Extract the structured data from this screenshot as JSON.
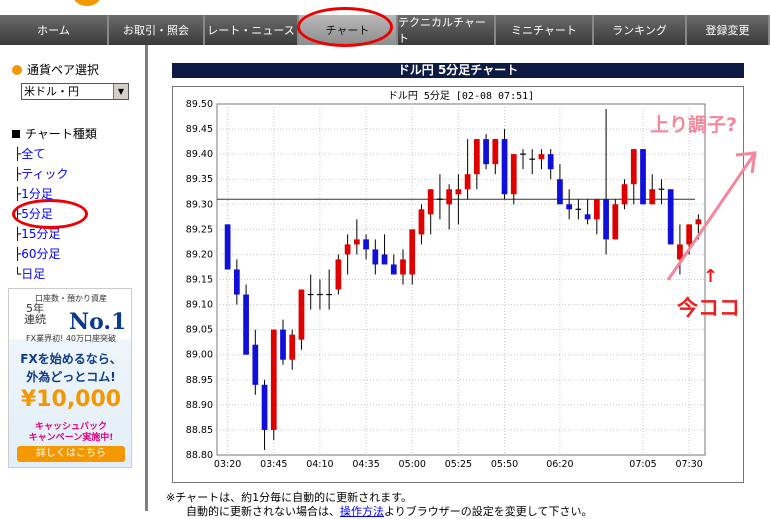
{
  "nav": {
    "tabs": [
      {
        "label": "ホーム",
        "active": false
      },
      {
        "label": "お取引・照会",
        "active": false
      },
      {
        "label": "レート・ニュース",
        "active": false
      },
      {
        "label": "チャート",
        "active": true
      },
      {
        "label": "テクニカルチャート",
        "active": false
      },
      {
        "label": "ミニチャート",
        "active": false
      },
      {
        "label": "ランキング",
        "active": false
      },
      {
        "label": "登録変更",
        "active": false
      }
    ]
  },
  "sidebar": {
    "pair_title": "通貨ペア選択",
    "pair_selected": "米ドル・円",
    "chart_type_title": "チャート種類",
    "chart_types": [
      {
        "tee": "├",
        "label": "全て"
      },
      {
        "tee": "├",
        "label": "ティック"
      },
      {
        "tee": "├",
        "label": "1分足"
      },
      {
        "tee": "├",
        "label": "5分足"
      },
      {
        "tee": "├",
        "label": "15分足"
      },
      {
        "tee": "├",
        "label": "60分足"
      },
      {
        "tee": "└",
        "label": "日足"
      }
    ]
  },
  "banner": {
    "line1": "口座数・預かり資産",
    "years": "5年",
    "consecutive": "連続",
    "no1": "No.1",
    "line3": "FX業界初! 40万口座突破",
    "fx_line": "FXを始めるなら、",
    "company": "外為どっとコム!",
    "amount": "¥10,000",
    "cashback": "キャッシュバック",
    "campaign": "キャンペーン実施中!",
    "details": "詳しくはこちら"
  },
  "main": {
    "title": "ドル円 5分足チャート",
    "note1": "※チャートは、約1分毎に自動的に更新されます。",
    "note2_pre": "自動的に更新されない場合は、",
    "note2_link": "操作方法",
    "note2_post": "よりブラウザーの設定を変更して下さい。"
  },
  "annotations": {
    "trend": "上り調子?",
    "now": "今ココ",
    "arrow": "↑"
  },
  "colors": {
    "up": "#e00000",
    "down": "#1010d8",
    "nav_active": "#a8a8a8",
    "title_bar": "#0d1a44",
    "annotation_red": "#ee1c1c",
    "annotation_pink": "#f6869c"
  },
  "chart_data": {
    "type": "candlestick",
    "title": "ドル円 5分足 [02-08 07:51]",
    "ylim": [
      88.8,
      89.5
    ],
    "y_ticks": [
      "89.50",
      "89.45",
      "89.40",
      "89.35",
      "89.30",
      "89.25",
      "89.20",
      "89.15",
      "89.10",
      "89.05",
      "89.00",
      "88.95",
      "88.90",
      "88.85",
      "88.80"
    ],
    "x_ticks": [
      "03:20",
      "03:45",
      "04:10",
      "04:35",
      "05:00",
      "05:25",
      "05:50",
      "06:20",
      "07:05",
      "07:30"
    ],
    "x_tick_index": [
      0,
      5,
      10,
      15,
      20,
      25,
      30,
      36,
      45,
      50
    ],
    "reference_line": 89.31,
    "candles": [
      {
        "o": 89.26,
        "h": 89.26,
        "l": 89.17,
        "c": 89.17
      },
      {
        "o": 89.17,
        "h": 89.19,
        "l": 89.1,
        "c": 89.12
      },
      {
        "o": 89.12,
        "h": 89.14,
        "l": 89.02,
        "c": 89.0
      },
      {
        "o": 89.02,
        "h": 89.05,
        "l": 88.92,
        "c": 88.94
      },
      {
        "o": 88.94,
        "h": 88.95,
        "l": 88.81,
        "c": 88.85
      },
      {
        "o": 88.85,
        "h": 89.05,
        "l": 88.83,
        "c": 89.05
      },
      {
        "o": 89.05,
        "h": 89.07,
        "l": 88.98,
        "c": 88.99
      },
      {
        "o": 88.99,
        "h": 89.05,
        "l": 88.97,
        "c": 89.04
      },
      {
        "o": 89.03,
        "h": 89.13,
        "l": 89.01,
        "c": 89.13
      },
      {
        "o": 89.12,
        "h": 89.16,
        "l": 89.09,
        "c": 89.12
      },
      {
        "o": 89.12,
        "h": 89.15,
        "l": 89.09,
        "c": 89.12
      },
      {
        "o": 89.12,
        "h": 89.17,
        "l": 89.09,
        "c": 89.12
      },
      {
        "o": 89.13,
        "h": 89.2,
        "l": 89.12,
        "c": 89.19
      },
      {
        "o": 89.2,
        "h": 89.24,
        "l": 89.16,
        "c": 89.22
      },
      {
        "o": 89.22,
        "h": 89.27,
        "l": 89.2,
        "c": 89.23
      },
      {
        "o": 89.23,
        "h": 89.24,
        "l": 89.19,
        "c": 89.21
      },
      {
        "o": 89.21,
        "h": 89.23,
        "l": 89.16,
        "c": 89.18
      },
      {
        "o": 89.2,
        "h": 89.24,
        "l": 89.18,
        "c": 89.18
      },
      {
        "o": 89.18,
        "h": 89.2,
        "l": 89.16,
        "c": 89.16
      },
      {
        "o": 89.16,
        "h": 89.21,
        "l": 89.14,
        "c": 89.19
      },
      {
        "o": 89.16,
        "h": 89.25,
        "l": 89.14,
        "c": 89.25
      },
      {
        "o": 89.24,
        "h": 89.3,
        "l": 89.22,
        "c": 89.29
      },
      {
        "o": 89.28,
        "h": 89.33,
        "l": 89.24,
        "c": 89.33
      },
      {
        "o": 89.31,
        "h": 89.36,
        "l": 89.27,
        "c": 89.31
      },
      {
        "o": 89.3,
        "h": 89.34,
        "l": 89.25,
        "c": 89.33
      },
      {
        "o": 89.32,
        "h": 89.36,
        "l": 89.26,
        "c": 89.33
      },
      {
        "o": 89.33,
        "h": 89.43,
        "l": 89.31,
        "c": 89.36
      },
      {
        "o": 89.36,
        "h": 89.43,
        "l": 89.33,
        "c": 89.43
      },
      {
        "o": 89.43,
        "h": 89.44,
        "l": 89.37,
        "c": 89.38
      },
      {
        "o": 89.38,
        "h": 89.43,
        "l": 89.36,
        "c": 89.43
      },
      {
        "o": 89.43,
        "h": 89.45,
        "l": 89.31,
        "c": 89.32
      },
      {
        "o": 89.32,
        "h": 89.4,
        "l": 89.3,
        "c": 89.4
      },
      {
        "o": 89.4,
        "h": 89.41,
        "l": 89.37,
        "c": 89.4
      },
      {
        "o": 89.39,
        "h": 89.41,
        "l": 89.36,
        "c": 89.39
      },
      {
        "o": 89.39,
        "h": 89.41,
        "l": 89.37,
        "c": 89.4
      },
      {
        "o": 89.4,
        "h": 89.41,
        "l": 89.35,
        "c": 89.37
      },
      {
        "o": 89.35,
        "h": 89.38,
        "l": 89.3,
        "c": 89.3
      },
      {
        "o": 89.3,
        "h": 89.33,
        "l": 89.27,
        "c": 89.29
      },
      {
        "o": 89.29,
        "h": 89.31,
        "l": 89.27,
        "c": 89.29
      },
      {
        "o": 89.28,
        "h": 89.31,
        "l": 89.26,
        "c": 89.27
      },
      {
        "o": 89.27,
        "h": 89.31,
        "l": 89.24,
        "c": 89.31
      },
      {
        "o": 89.31,
        "h": 89.49,
        "l": 89.2,
        "c": 89.23
      },
      {
        "o": 89.23,
        "h": 89.31,
        "l": 89.23,
        "c": 89.3
      },
      {
        "o": 89.3,
        "h": 89.35,
        "l": 89.29,
        "c": 89.34
      },
      {
        "o": 89.34,
        "h": 89.41,
        "l": 89.3,
        "c": 89.41
      },
      {
        "o": 89.41,
        "h": 89.41,
        "l": 89.3,
        "c": 89.3
      },
      {
        "o": 89.3,
        "h": 89.36,
        "l": 89.3,
        "c": 89.33
      },
      {
        "o": 89.33,
        "h": 89.35,
        "l": 89.3,
        "c": 89.33
      },
      {
        "o": 89.33,
        "h": 89.33,
        "l": 89.22,
        "c": 89.22
      },
      {
        "o": 89.19,
        "h": 89.26,
        "l": 89.16,
        "c": 89.22
      },
      {
        "o": 89.22,
        "h": 89.26,
        "l": 89.2,
        "c": 89.26
      },
      {
        "o": 89.26,
        "h": 89.28,
        "l": 89.23,
        "c": 89.27
      }
    ]
  }
}
